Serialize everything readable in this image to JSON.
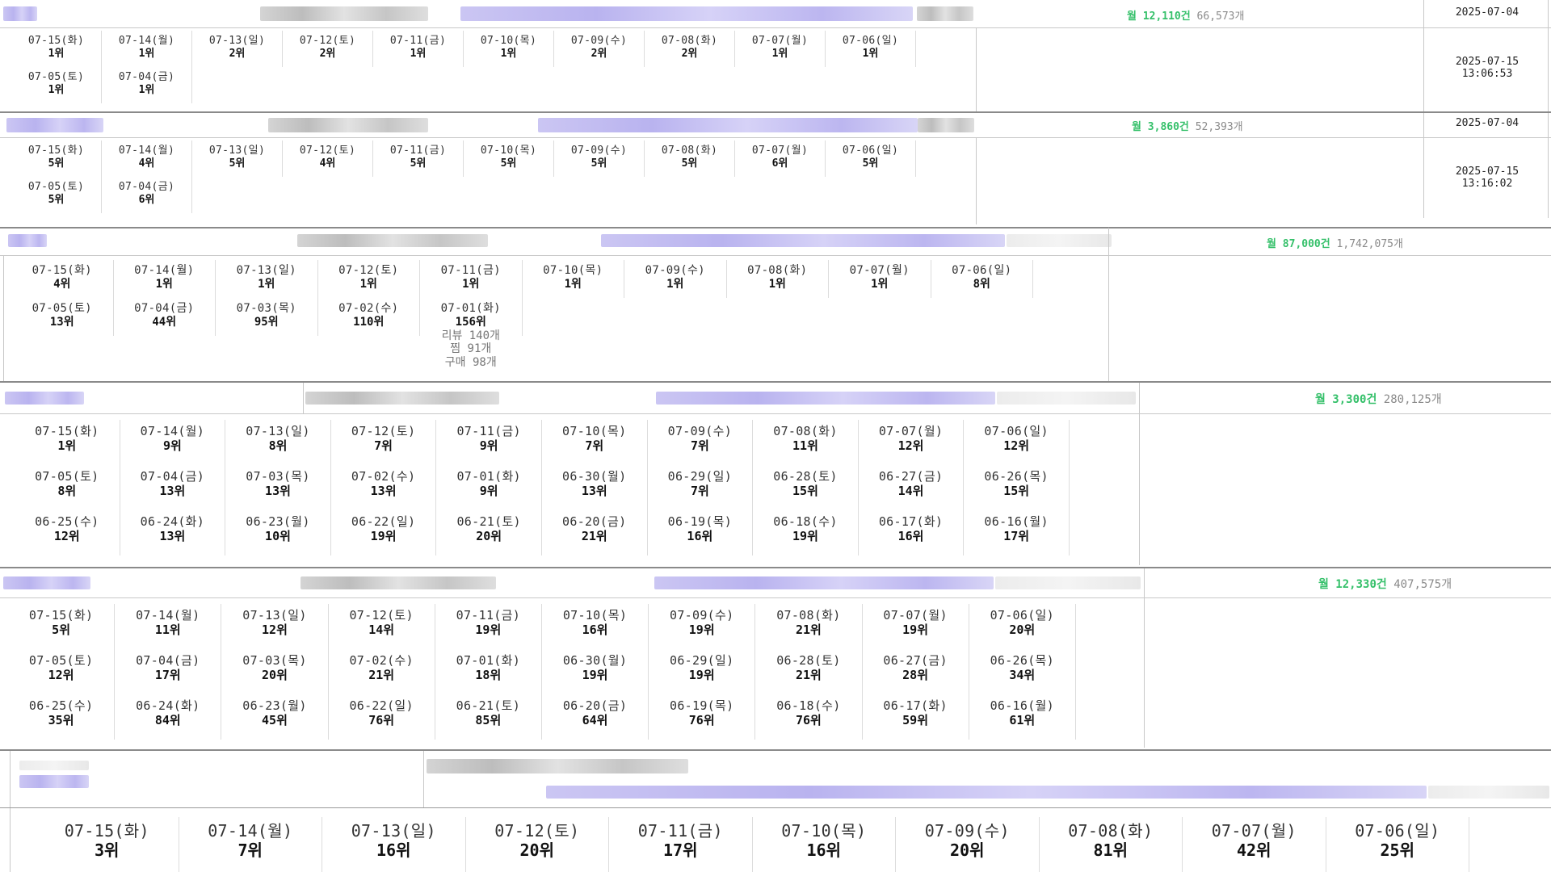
{
  "products": [
    {
      "stats": {
        "monthly": "월 12,110건",
        "count": "66,573개"
      },
      "reg_date": "2025-07-04",
      "checked_at": [
        "2025-07-15",
        "13:06:53"
      ],
      "ranks": [
        {
          "date": "07-15(화)",
          "rank": "1위"
        },
        {
          "date": "07-14(월)",
          "rank": "1위"
        },
        {
          "date": "07-13(일)",
          "rank": "2위"
        },
        {
          "date": "07-12(토)",
          "rank": "2위"
        },
        {
          "date": "07-11(금)",
          "rank": "1위"
        },
        {
          "date": "07-10(목)",
          "rank": "1위"
        },
        {
          "date": "07-09(수)",
          "rank": "2위"
        },
        {
          "date": "07-08(화)",
          "rank": "2위"
        },
        {
          "date": "07-07(월)",
          "rank": "1위"
        },
        {
          "date": "07-06(일)",
          "rank": "1위"
        },
        {
          "date": "07-05(토)",
          "rank": "1위"
        },
        {
          "date": "07-04(금)",
          "rank": "1위"
        }
      ]
    },
    {
      "stats": {
        "monthly": "월 3,860건",
        "count": "52,393개"
      },
      "reg_date": "2025-07-04",
      "checked_at": [
        "2025-07-15",
        "13:16:02"
      ],
      "ranks": [
        {
          "date": "07-15(화)",
          "rank": "5위"
        },
        {
          "date": "07-14(월)",
          "rank": "4위"
        },
        {
          "date": "07-13(일)",
          "rank": "5위"
        },
        {
          "date": "07-12(토)",
          "rank": "4위"
        },
        {
          "date": "07-11(금)",
          "rank": "5위"
        },
        {
          "date": "07-10(목)",
          "rank": "5위"
        },
        {
          "date": "07-09(수)",
          "rank": "5위"
        },
        {
          "date": "07-08(화)",
          "rank": "5위"
        },
        {
          "date": "07-07(월)",
          "rank": "6위"
        },
        {
          "date": "07-06(일)",
          "rank": "5위"
        },
        {
          "date": "07-05(토)",
          "rank": "5위"
        },
        {
          "date": "07-04(금)",
          "rank": "6위"
        }
      ]
    },
    {
      "stats": {
        "monthly": "월 87,000건",
        "count": "1,742,075개"
      },
      "ranks": [
        {
          "date": "07-15(화)",
          "rank": "4위"
        },
        {
          "date": "07-14(월)",
          "rank": "1위"
        },
        {
          "date": "07-13(일)",
          "rank": "1위"
        },
        {
          "date": "07-12(토)",
          "rank": "1위"
        },
        {
          "date": "07-11(금)",
          "rank": "1위"
        },
        {
          "date": "07-10(목)",
          "rank": "1위"
        },
        {
          "date": "07-09(수)",
          "rank": "1위"
        },
        {
          "date": "07-08(화)",
          "rank": "1위"
        },
        {
          "date": "07-07(월)",
          "rank": "1위"
        },
        {
          "date": "07-06(일)",
          "rank": "8위"
        },
        {
          "date": "07-05(토)",
          "rank": "13위"
        },
        {
          "date": "07-04(금)",
          "rank": "44위"
        },
        {
          "date": "07-03(목)",
          "rank": "95위"
        },
        {
          "date": "07-02(수)",
          "rank": "110위"
        },
        {
          "date": "07-01(화)",
          "rank": "156위",
          "extra": [
            "리뷰 140개",
            "찜 91개",
            "구매 98개"
          ]
        }
      ]
    },
    {
      "stats": {
        "monthly": "월 3,300건",
        "count": "280,125개"
      },
      "ranks": [
        {
          "date": "07-15(화)",
          "rank": "1위"
        },
        {
          "date": "07-14(월)",
          "rank": "9위"
        },
        {
          "date": "07-13(일)",
          "rank": "8위"
        },
        {
          "date": "07-12(토)",
          "rank": "7위"
        },
        {
          "date": "07-11(금)",
          "rank": "9위"
        },
        {
          "date": "07-10(목)",
          "rank": "7위"
        },
        {
          "date": "07-09(수)",
          "rank": "7위"
        },
        {
          "date": "07-08(화)",
          "rank": "11위"
        },
        {
          "date": "07-07(월)",
          "rank": "12위"
        },
        {
          "date": "07-06(일)",
          "rank": "12위"
        },
        {
          "date": "07-05(토)",
          "rank": "8위"
        },
        {
          "date": "07-04(금)",
          "rank": "13위"
        },
        {
          "date": "07-03(목)",
          "rank": "13위"
        },
        {
          "date": "07-02(수)",
          "rank": "13위"
        },
        {
          "date": "07-01(화)",
          "rank": "9위"
        },
        {
          "date": "06-30(월)",
          "rank": "13위"
        },
        {
          "date": "06-29(일)",
          "rank": "7위"
        },
        {
          "date": "06-28(토)",
          "rank": "15위"
        },
        {
          "date": "06-27(금)",
          "rank": "14위"
        },
        {
          "date": "06-26(목)",
          "rank": "15위"
        },
        {
          "date": "06-25(수)",
          "rank": "12위"
        },
        {
          "date": "06-24(화)",
          "rank": "13위"
        },
        {
          "date": "06-23(월)",
          "rank": "10위"
        },
        {
          "date": "06-22(일)",
          "rank": "19위"
        },
        {
          "date": "06-21(토)",
          "rank": "20위"
        },
        {
          "date": "06-20(금)",
          "rank": "21위"
        },
        {
          "date": "06-19(목)",
          "rank": "16위"
        },
        {
          "date": "06-18(수)",
          "rank": "19위"
        },
        {
          "date": "06-17(화)",
          "rank": "16위"
        },
        {
          "date": "06-16(월)",
          "rank": "17위"
        }
      ]
    },
    {
      "stats": {
        "monthly": "월 12,330건",
        "count": "407,575개"
      },
      "ranks": [
        {
          "date": "07-15(화)",
          "rank": "5위"
        },
        {
          "date": "07-14(월)",
          "rank": "11위"
        },
        {
          "date": "07-13(일)",
          "rank": "12위"
        },
        {
          "date": "07-12(토)",
          "rank": "14위"
        },
        {
          "date": "07-11(금)",
          "rank": "19위"
        },
        {
          "date": "07-10(목)",
          "rank": "16위"
        },
        {
          "date": "07-09(수)",
          "rank": "19위"
        },
        {
          "date": "07-08(화)",
          "rank": "21위"
        },
        {
          "date": "07-07(월)",
          "rank": "19위"
        },
        {
          "date": "07-06(일)",
          "rank": "20위"
        },
        {
          "date": "07-05(토)",
          "rank": "12위"
        },
        {
          "date": "07-04(금)",
          "rank": "17위"
        },
        {
          "date": "07-03(목)",
          "rank": "20위"
        },
        {
          "date": "07-02(수)",
          "rank": "21위"
        },
        {
          "date": "07-01(화)",
          "rank": "18위"
        },
        {
          "date": "06-30(월)",
          "rank": "19위"
        },
        {
          "date": "06-29(일)",
          "rank": "19위"
        },
        {
          "date": "06-28(토)",
          "rank": "21위"
        },
        {
          "date": "06-27(금)",
          "rank": "28위"
        },
        {
          "date": "06-26(목)",
          "rank": "34위"
        },
        {
          "date": "06-25(수)",
          "rank": "35위"
        },
        {
          "date": "06-24(화)",
          "rank": "84위"
        },
        {
          "date": "06-23(월)",
          "rank": "45위"
        },
        {
          "date": "06-22(일)",
          "rank": "76위"
        },
        {
          "date": "06-21(토)",
          "rank": "85위"
        },
        {
          "date": "06-20(금)",
          "rank": "64위"
        },
        {
          "date": "06-19(목)",
          "rank": "76위"
        },
        {
          "date": "06-18(수)",
          "rank": "76위"
        },
        {
          "date": "06-17(화)",
          "rank": "59위"
        },
        {
          "date": "06-16(월)",
          "rank": "61위"
        }
      ]
    },
    {
      "ranks": [
        {
          "date": "07-15(화)",
          "rank": "3위"
        },
        {
          "date": "07-14(월)",
          "rank": "7위"
        },
        {
          "date": "07-13(일)",
          "rank": "16위"
        },
        {
          "date": "07-12(토)",
          "rank": "20위"
        },
        {
          "date": "07-11(금)",
          "rank": "17위"
        },
        {
          "date": "07-10(목)",
          "rank": "16위"
        },
        {
          "date": "07-09(수)",
          "rank": "20위"
        },
        {
          "date": "07-08(화)",
          "rank": "81위"
        },
        {
          "date": "07-07(월)",
          "rank": "42위"
        },
        {
          "date": "07-06(일)",
          "rank": "25위"
        }
      ]
    }
  ]
}
